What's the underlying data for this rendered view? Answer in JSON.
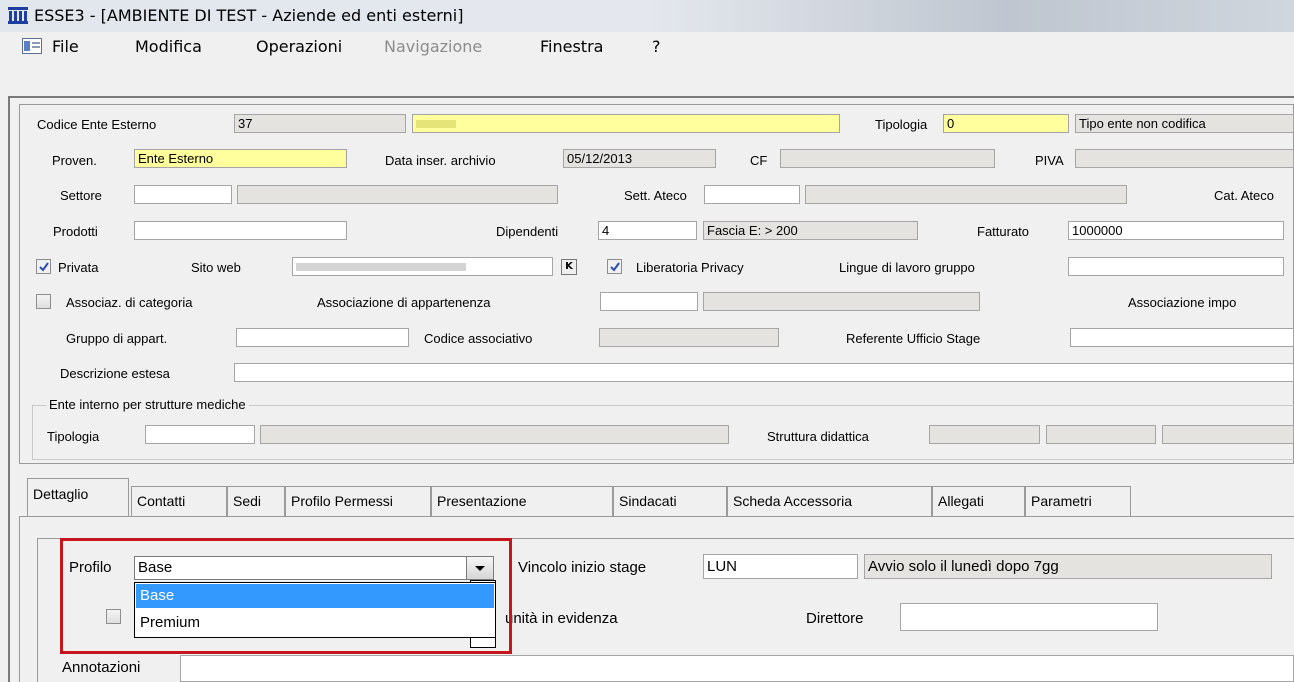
{
  "window": {
    "title": "ESSE3 - [AMBIENTE DI TEST - Aziende ed enti esterni]"
  },
  "menu": {
    "file": "File",
    "modifica": "Modifica",
    "operazioni": "Operazioni",
    "navigazione": "Navigazione",
    "finestra": "Finestra",
    "help": "?"
  },
  "form": {
    "codice_label": "Codice Ente Esterno",
    "codice_value": "37",
    "nome_value": "",
    "tipologia_label": "Tipologia",
    "tipologia_value": "0",
    "tipologia_desc": "Tipo ente non codifica",
    "proven_label": "Proven.",
    "proven_value": "Ente Esterno",
    "data_label": "Data inser. archivio",
    "data_value": "05/12/2013",
    "cf_label": "CF",
    "cf_value": "",
    "piva_label": "PIVA",
    "piva_value": "",
    "settore_label": "Settore",
    "sett_ateco_label": "Sett. Ateco",
    "cat_ateco_label": "Cat. Ateco",
    "prodotti_label": "Prodotti",
    "dipendenti_label": "Dipendenti",
    "dipendenti_value": "4",
    "fascia_value": "Fascia E: > 200",
    "fatturato_label": "Fatturato",
    "fatturato_value": "1000000",
    "privata_label": "Privata",
    "privata_checked": true,
    "sito_web_label": "Sito web",
    "sito_web_value": "",
    "sito_btn": "K",
    "liberatoria_label": "Liberatoria Privacy",
    "liberatoria_checked": true,
    "lingue_label": "Lingue di lavoro gruppo",
    "associaz_label": "Associaz. di categoria",
    "associaz_checked": false,
    "assoc_appart_label": "Associazione di appartenenza",
    "assoc_impo_label": "Associazione impo",
    "gruppo_label": "Gruppo di appart.",
    "codice_assoc_label": "Codice associativo",
    "referente_label": "Referente Ufficio Stage",
    "descrizione_label": "Descrizione estesa",
    "ente_interno_group": "Ente interno per strutture mediche",
    "tipologia2_label": "Tipologia",
    "struttura_label": "Struttura didattica"
  },
  "tabs": [
    "Dettaglio",
    "Contatti",
    "Sedi",
    "Profilo Permessi",
    "Presentazione",
    "Sindacati",
    "Scheda Accessoria",
    "Allegati",
    "Parametri"
  ],
  "detail": {
    "profilo_label": "Profilo",
    "profilo_value": "Base",
    "profilo_options": [
      "Base",
      "Premium"
    ],
    "profilo_selected_index": 0,
    "vincolo_label": "Vincolo inizio stage",
    "vincolo_value": "LUN",
    "vincolo_desc": "Avvio solo il lunedì dopo 7gg",
    "opportunita_label": "unità in evidenza",
    "direttore_label": "Direttore",
    "annotazioni_label": "Annotazioni"
  },
  "colors": {
    "yellow_field": "#ffff9d",
    "readonly_field": "#e5e3df",
    "selection": "#3399ff",
    "highlight": "#c6161b"
  }
}
